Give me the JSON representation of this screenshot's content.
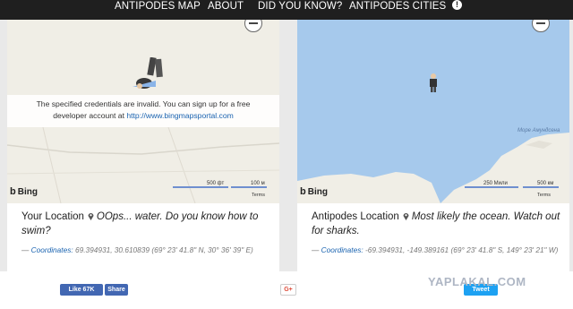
{
  "nav": {
    "items": [
      "ANTIPODES MAP",
      "ABOUT",
      "DID YOU KNOW?",
      "ANTIPODES CITIES"
    ],
    "info_icon": "info-icon"
  },
  "left": {
    "error_line1": "The specified credentials are invalid. You can sign up for a free",
    "error_line2_prefix": "developer account at ",
    "error_link": "http://www.bingmapsportal.com",
    "bing": "Bing",
    "scale1": "500 фт",
    "scale2": "100 м",
    "terms": "Terms",
    "title": "Your Location",
    "message": "OOps... water. Do you know how to swim?",
    "coords_label": "Coordinates:",
    "coords_value": "69.394931, 30.610839 (69° 23' 41.8\" N, 30° 36' 39\" E)",
    "dash": "— "
  },
  "right": {
    "sea_label": "Море Амундсена",
    "bing": "Bing",
    "scale1": "250 Мили",
    "scale2": "500 км",
    "terms": "Terms",
    "title": "Antipodes Location",
    "message": "Most likely the ocean. Watch out for sharks.",
    "coords_label": "Coordinates:",
    "coords_value": "-69.394931, -149.389161 (69° 23' 41.8\" S, 149° 23' 21\" W)",
    "dash": "— "
  },
  "footer": {
    "like": "Like 67K",
    "share": "Share",
    "gplus": "G+",
    "tweet": "Tweet",
    "watermark": "YAPLAKAL.COM"
  },
  "colors": {
    "nav_bg": "#1f1f1f",
    "sea": "#a6c9ec",
    "land": "#f0eee6",
    "link": "#1a63b0",
    "facebook": "#4267b2",
    "twitter": "#1da1f2"
  }
}
